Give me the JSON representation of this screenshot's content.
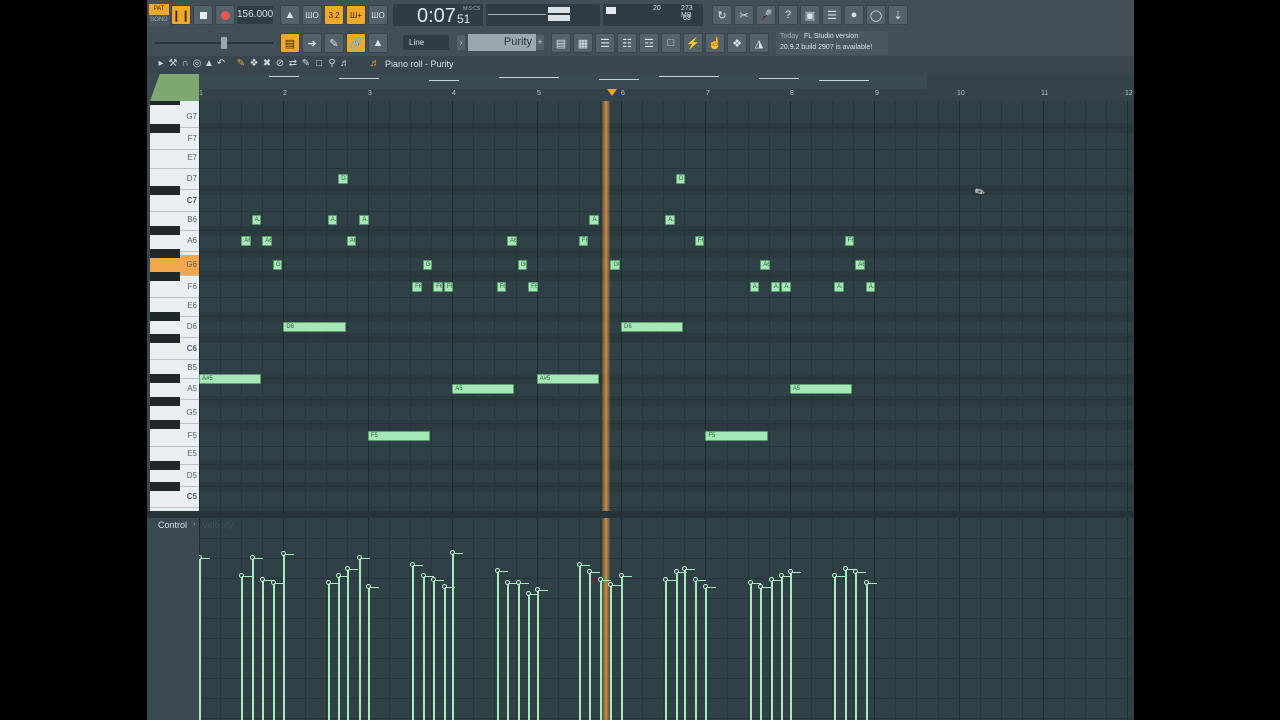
{
  "toolbar": {
    "pat_label": "PAT",
    "song_label": "SONG",
    "tempo": "156.000",
    "time_main": "0:07",
    "time_sub": "51",
    "time_unit": "M:S:CS",
    "cpu_top": "20",
    "ram_label": "273 MB",
    "poly_label": "63",
    "snap_label": "Line",
    "pattern_name": "Purity",
    "hint_today": "Today",
    "hint_title": "FL Studio version",
    "hint_body": "20.9.2 build 2907 is available!"
  },
  "pianoroll": {
    "title": "Piano roll - Purity",
    "bars": [
      "2",
      "3",
      "4",
      "5",
      "6",
      "7",
      "8",
      "9",
      "10",
      "11",
      "12"
    ],
    "key_labels": [
      "G7",
      "F7",
      "E7",
      "D7",
      "C7",
      "B6",
      "A6",
      "G6",
      "F6",
      "E6",
      "D6",
      "C6",
      "B5",
      "A5",
      "G5",
      "F5",
      "E5",
      "D5",
      "C5"
    ],
    "notes": [
      "A#5",
      "D6",
      "F5",
      "A5",
      "A#5",
      "D6",
      "F5",
      "A5",
      "D7",
      "D7",
      "G6",
      "G6",
      "G6",
      "G6",
      "A6",
      "A6",
      "A6",
      "A6",
      "A6",
      "A6",
      "F6",
      "F6",
      "F6",
      "F6",
      "F6",
      "F6",
      "F6",
      "F6",
      "A.",
      "A.",
      "A.",
      "A.",
      "A."
    ]
  },
  "control": {
    "label": "Control",
    "target": "Velocity"
  },
  "colors": {
    "accent": "#f0a82a",
    "note": "#a3e8b5",
    "grid_bg": "#2f4146"
  }
}
